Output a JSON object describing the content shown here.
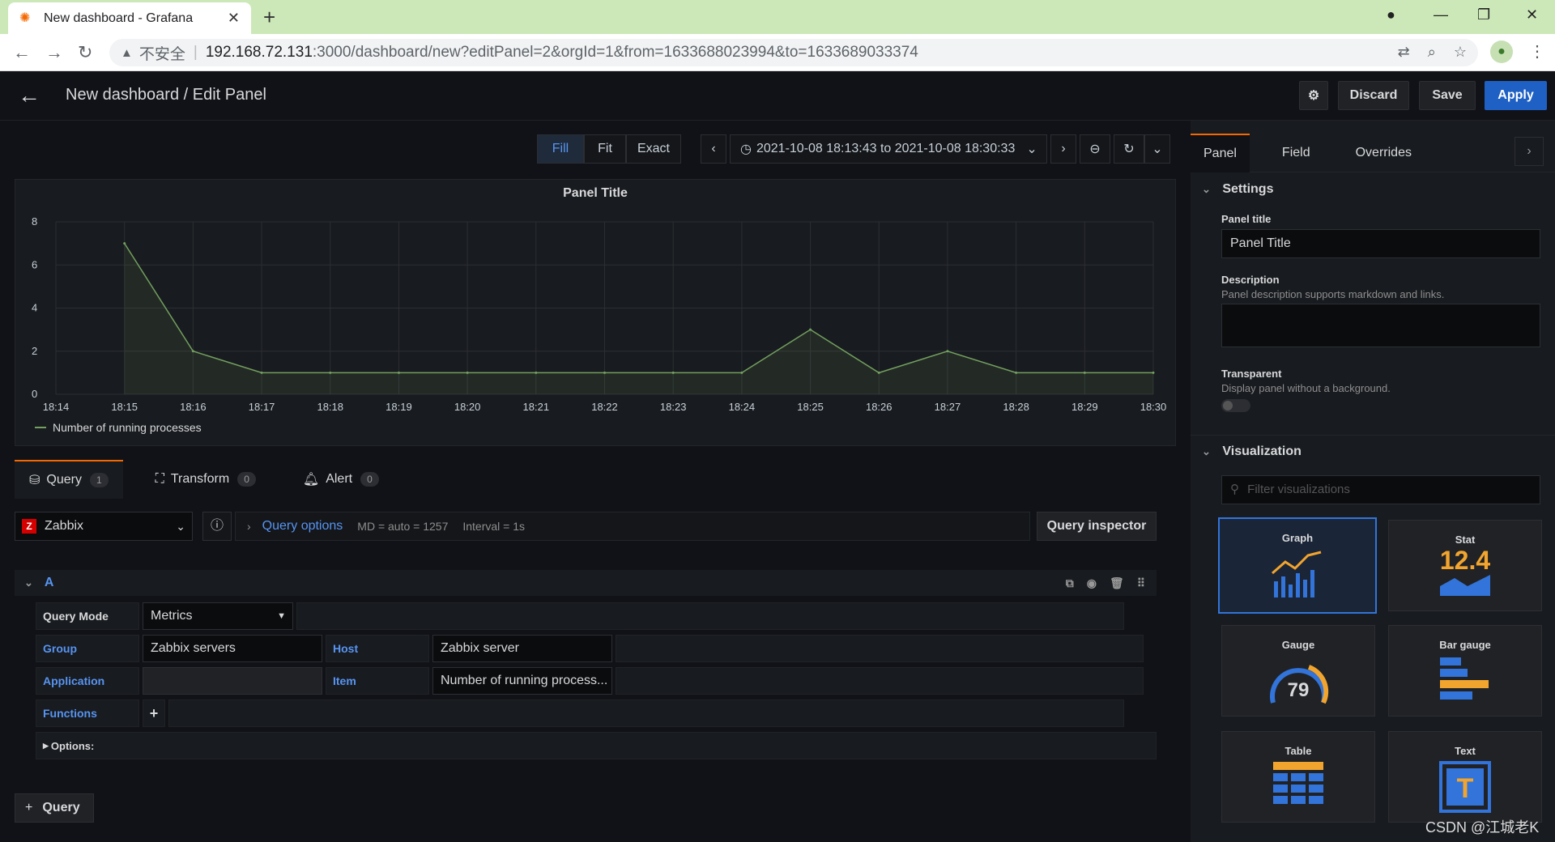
{
  "browser": {
    "tab_title": "New dashboard - Grafana",
    "url_host": "192.168.72.131",
    "url_rest": ":3000/dashboard/new?editPanel=2&orgId=1&from=1633688023994&to=1633689033374",
    "insecure_label": "不安全"
  },
  "header": {
    "breadcrumb": "New dashboard / Edit Panel",
    "discard_label": "Discard",
    "save_label": "Save",
    "apply_label": "Apply"
  },
  "timebar": {
    "fill_label": "Fill",
    "fit_label": "Fit",
    "exact_label": "Exact",
    "range": "2021-10-08 18:13:43 to 2021-10-08 18:30:33"
  },
  "chart_data": {
    "type": "area",
    "title": "Panel Title",
    "x": [
      "18:14",
      "18:15",
      "18:16",
      "18:17",
      "18:18",
      "18:19",
      "18:20",
      "18:21",
      "18:22",
      "18:23",
      "18:24",
      "18:25",
      "18:26",
      "18:27",
      "18:28",
      "18:29",
      "18:30"
    ],
    "series": [
      {
        "name": "Number of running processes",
        "x": [
          "18:15",
          "18:16",
          "18:17",
          "18:18",
          "18:19",
          "18:20",
          "18:21",
          "18:22",
          "18:23",
          "18:24",
          "18:25",
          "18:26",
          "18:27",
          "18:28",
          "18:29",
          "18:30"
        ],
        "values": [
          7,
          2,
          1,
          1,
          1,
          1,
          1,
          1,
          1,
          1,
          3,
          1,
          2,
          1,
          1,
          1
        ]
      }
    ],
    "yticks": [
      0,
      2,
      4,
      6,
      8
    ],
    "ylim": [
      0,
      8
    ],
    "grid": true,
    "color": "#73a05e"
  },
  "query_tabs": {
    "query_label": "Query",
    "query_count": "1",
    "transform_label": "Transform",
    "transform_count": "0",
    "alert_label": "Alert",
    "alert_count": "0"
  },
  "query": {
    "datasource": "Zabbix",
    "options_label": "Query options",
    "md": "MD = auto = 1257",
    "interval": "Interval = 1s",
    "inspector_label": "Query inspector",
    "ref_id": "A",
    "mode_label": "Query Mode",
    "mode_value": "Metrics",
    "group_label": "Group",
    "group_value": "Zabbix servers",
    "host_label": "Host",
    "host_value": "Zabbix server",
    "application_label": "Application",
    "application_value": "",
    "item_label": "Item",
    "item_value": "Number of running process...",
    "functions_label": "Functions",
    "options_toggle": "Options:",
    "add_query_label": "Query"
  },
  "right_pane": {
    "tabs": [
      "Panel",
      "Field",
      "Overrides"
    ],
    "settings_title": "Settings",
    "panel_title_label": "Panel title",
    "panel_title_value": "Panel Title",
    "description_label": "Description",
    "description_hint": "Panel description supports markdown and links.",
    "transparent_label": "Transparent",
    "transparent_hint": "Display panel without a background.",
    "visualization_title": "Visualization",
    "filter_placeholder": "Filter visualizations",
    "viz": [
      "Graph",
      "Stat",
      "Gauge",
      "Bar gauge",
      "Table",
      "Text"
    ],
    "stat_value": "12.4",
    "gauge_value": "79",
    "text_glyph": "T"
  },
  "watermark": "CSDN @江城老K"
}
